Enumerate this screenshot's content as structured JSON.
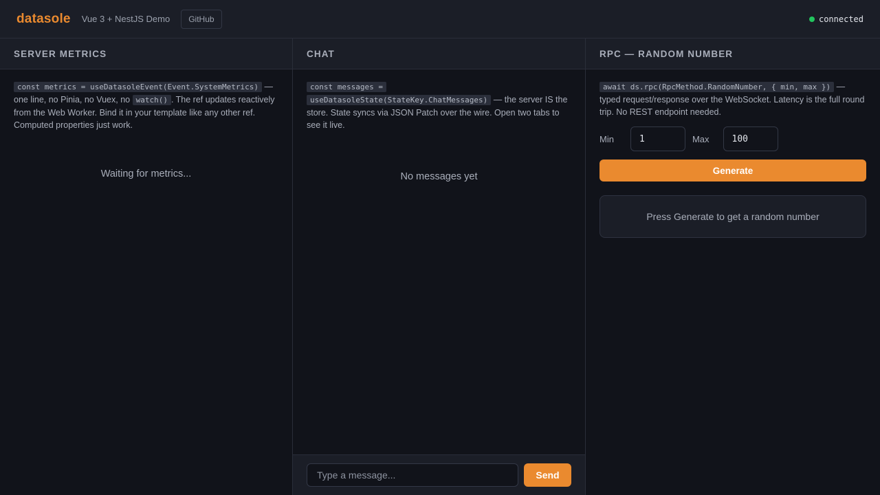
{
  "header": {
    "brand": "datasole",
    "subtitle": "Vue 3 + NestJS Demo",
    "github_label": "GitHub",
    "status_text": "connected",
    "status_color": "#22c55e"
  },
  "metrics": {
    "title": "SERVER METRICS",
    "code1": "const metrics = useDatasoleEvent(Event.SystemMetrics)",
    "text1": " — one line, no Pinia, no Vuex, no ",
    "code2": "watch()",
    "text2": ". The ref updates reactively from the Web Worker. Bind it in your template like any other ref. Computed properties just work.",
    "waiting": "Waiting for metrics..."
  },
  "chat": {
    "title": "CHAT",
    "code1": "const messages =",
    "code2": "useDatasoleState(StateKey.ChatMessages)",
    "text1": " — the server IS the store. State syncs via JSON Patch over the wire. Open two tabs to see it live.",
    "empty": "No messages yet",
    "input_placeholder": "Type a message...",
    "send_label": "Send"
  },
  "rpc": {
    "title": "RPC — RANDOM NUMBER",
    "code1": "await ds.rpc(RpcMethod.RandomNumber, { min, max })",
    "text1": " — typed request/response over the WebSocket. Latency is the full round trip. No REST endpoint needed.",
    "min_label": "Min",
    "min_value": "1",
    "max_label": "Max",
    "max_value": "100",
    "generate_label": "Generate",
    "result_placeholder": "Press Generate to get a random number"
  },
  "colors": {
    "accent": "#ea8a2f",
    "background": "#11131a",
    "panel": "#1b1e27"
  }
}
